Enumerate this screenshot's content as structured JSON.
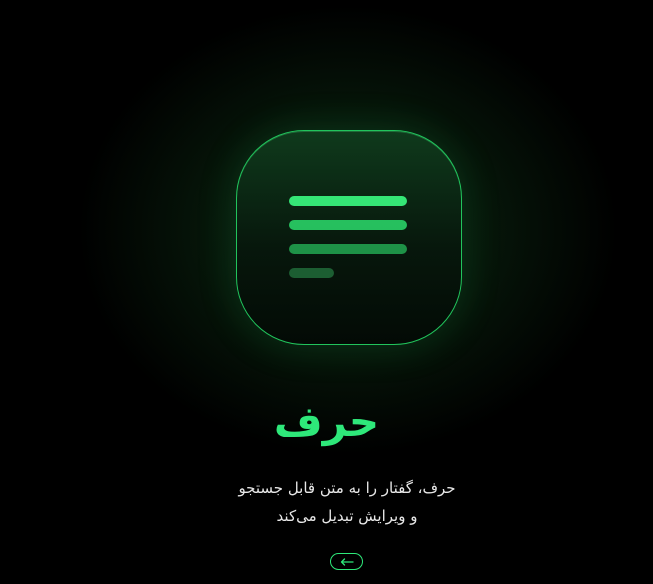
{
  "app": {
    "title": "حرف",
    "description_line_1": "حرف، گفتار را به متن قابل جستجو",
    "description_line_2": "و ویرایش تبدیل می‌کند"
  },
  "icon": {
    "name": "document-lines-icon",
    "accent_color": "#2ee87a"
  },
  "navigation": {
    "next_button_icon": "arrow-left-icon"
  },
  "colors": {
    "background": "#000000",
    "accent": "#2ee87a"
  }
}
